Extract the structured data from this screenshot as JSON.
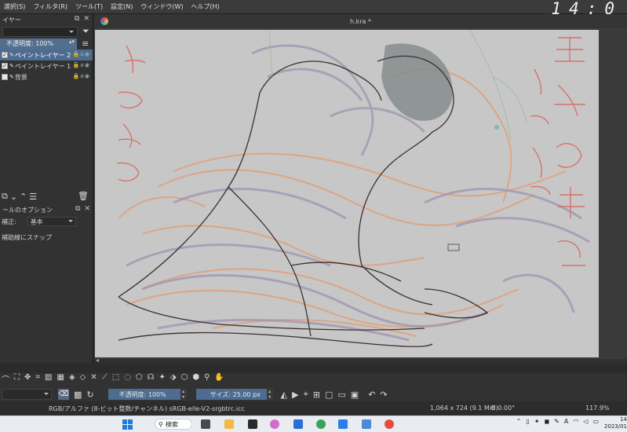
{
  "menubar": {
    "items": [
      "選択(S)",
      "フィルタ(R)",
      "ツール(T)",
      "設定(N)",
      "ウィンドウ(W)",
      "ヘルプ(H)"
    ],
    "clock_overlay": "14:0"
  },
  "layers_docker": {
    "title": "イヤー",
    "opacity_label": "不透明度: 100%",
    "layers": [
      {
        "name": "ペイントレイヤー 2",
        "active": true
      },
      {
        "name": "ペイントレイヤー 1",
        "active": false
      },
      {
        "name": "背景",
        "active": false
      }
    ]
  },
  "tool_options": {
    "title": "ールのオプション",
    "correction_label": "補正:",
    "correction_value": "基本",
    "snap_label": "補助線にスナップ"
  },
  "canvas": {
    "document_title": "h.kra *",
    "background_color": "#c7c7c7"
  },
  "brush_toolbar": {
    "opacity": "不透明度: 100%",
    "size": "サイズ: 25.00 px"
  },
  "statusbar": {
    "color_info": "RGB/アルファ (8-ビット整数/チャンネル)  sRGB-elle-V2-srgbtrc.icc",
    "dims": "1,064 x 724 (9.1 MiB)",
    "rotation": "0.00°",
    "zoom": "117.9%"
  },
  "taskbar": {
    "search_label": "検索",
    "clock_time": "14",
    "clock_date": "2023/01"
  }
}
